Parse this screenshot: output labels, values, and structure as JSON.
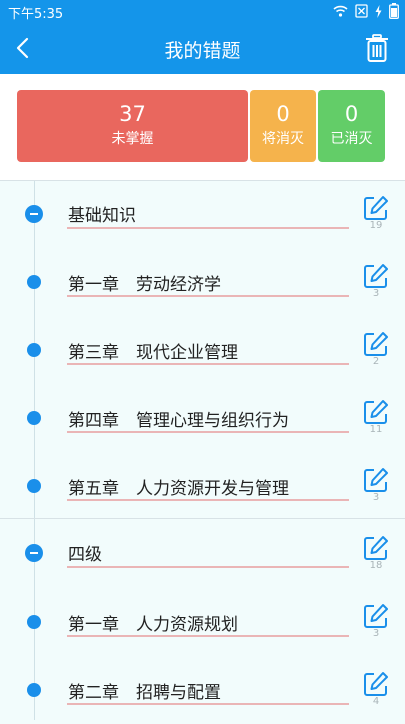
{
  "status": {
    "time": "下午5:35"
  },
  "header": {
    "title": "我的错题"
  },
  "stats": [
    {
      "value": "37",
      "label": "未掌握",
      "color": "#e9675e"
    },
    {
      "value": "0",
      "label": "将消灭",
      "color": "#f5b34c"
    },
    {
      "value": "0",
      "label": "已消灭",
      "color": "#63cd68"
    }
  ],
  "sections": [
    {
      "title": "基础知识",
      "count": "19",
      "items": [
        {
          "title": "第一章　劳动经济学",
          "count": "3"
        },
        {
          "title": "第三章　现代企业管理",
          "count": "2"
        },
        {
          "title": "第四章　管理心理与组织行为",
          "count": "11"
        },
        {
          "title": "第五章　人力资源开发与管理",
          "count": "3"
        }
      ]
    },
    {
      "title": "四级",
      "count": "18",
      "items": [
        {
          "title": "第一章　人力资源规划",
          "count": "3"
        },
        {
          "title": "第二章　招聘与配置",
          "count": "4"
        }
      ]
    }
  ],
  "colors": {
    "accent": "#1495ea",
    "underline": "#eab5b6"
  },
  "icons": {
    "back": "chevron-left-icon",
    "trash": "trash-icon",
    "edit": "edit-icon"
  }
}
